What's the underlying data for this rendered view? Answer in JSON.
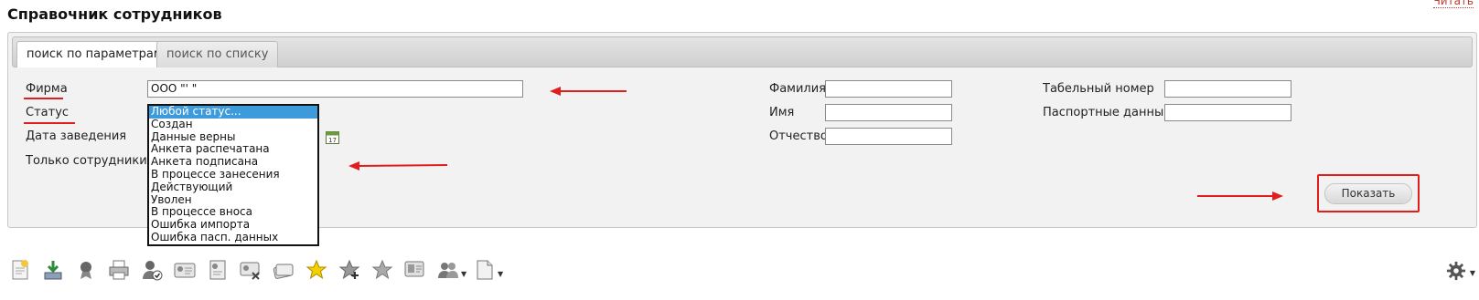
{
  "page": {
    "title": "Справочник сотрудников",
    "top_link": "Читать"
  },
  "tabs": [
    {
      "label": "поиск по параметрам",
      "active": true
    },
    {
      "label": "поиск по списку",
      "active": false
    }
  ],
  "form": {
    "firm": {
      "label": "Фирма",
      "value": "ООО \"'                \""
    },
    "status": {
      "label": "Статус"
    },
    "date": {
      "label": "Дата заведения"
    },
    "only": {
      "label": "Только сотрудники в р"
    },
    "last_name": {
      "label": "Фамилия",
      "value": ""
    },
    "first_name": {
      "label": "Имя",
      "value": ""
    },
    "patronymic": {
      "label": "Отчество",
      "value": ""
    },
    "tab_number": {
      "label": "Табельный номер",
      "value": ""
    },
    "passport": {
      "label": "Паспортные данные",
      "value": ""
    }
  },
  "status_options": [
    "Любой статус...",
    "Создан",
    "Данные верны",
    "Анкета распечатана",
    "Анкета подписана",
    "В процессе занесения",
    "Действующий",
    "Уволен",
    "В процессе вноса",
    "Ошибка импорта",
    "Ошибка пасп. данных"
  ],
  "status_selected_index": 0,
  "buttons": {
    "show": "Показать"
  },
  "calendar_day": "17",
  "colors": {
    "accent_red": "#e21d1d",
    "selected_blue": "#3d9bdc"
  },
  "toolbar_icons": [
    "new-document-icon",
    "download-icon",
    "award-icon",
    "print-icon",
    "user-check-icon",
    "id-card-icon",
    "id-card-edit-icon",
    "id-card-delete-icon",
    "cards-icon",
    "star-icon",
    "star-add-icon",
    "star-remove-icon",
    "card-photo-icon",
    "users-menu-icon",
    "document-menu-icon"
  ],
  "settings_icon": "gear-icon"
}
